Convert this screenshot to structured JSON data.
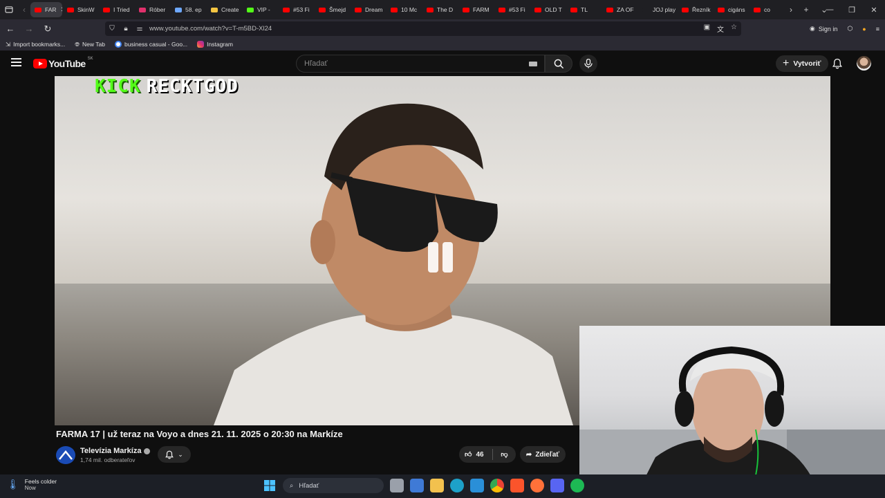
{
  "browser": {
    "tabs": [
      {
        "label": "FAR",
        "color": "#ff0000",
        "active": true
      },
      {
        "label": "SkinW",
        "color": "#ff0000"
      },
      {
        "label": "I Tried",
        "color": "#ff0000"
      },
      {
        "label": "Róber",
        "color": "#e1306c"
      },
      {
        "label": "58. ep",
        "color": "#6ea8ff"
      },
      {
        "label": "Create",
        "color": "#f4c542"
      },
      {
        "label": "VIP -",
        "color": "#53fc18"
      },
      {
        "label": "#53 Fi",
        "color": "#ff0000"
      },
      {
        "label": "Šmejd",
        "color": "#ff0000"
      },
      {
        "label": "Dream",
        "color": "#ff0000"
      },
      {
        "label": "10 Mc",
        "color": "#ff0000"
      },
      {
        "label": "The D",
        "color": "#ff0000"
      },
      {
        "label": "FARM",
        "color": "#ff0000"
      },
      {
        "label": "#53 Fi",
        "color": "#ff0000"
      },
      {
        "label": "OLD T",
        "color": "#ff0000"
      },
      {
        "label": "TL",
        "color": "#ff0000"
      },
      {
        "label": "ZA OF",
        "color": "#ff0000"
      },
      {
        "label": "JOJ play",
        "color": "#1f1f23"
      },
      {
        "label": "Řezník",
        "color": "#ff0000"
      },
      {
        "label": "cigáns",
        "color": "#ff0000"
      },
      {
        "label": "co",
        "color": "#ff0000"
      }
    ],
    "url": "www.youtube.com/watch?v=T-m5BD-Xl24",
    "sign_in": "Sign in",
    "bookmarks": [
      {
        "label": "Import bookmarks...",
        "icon": "import-icon"
      },
      {
        "label": "New Tab",
        "icon": "globe-icon"
      },
      {
        "label": "business casual - Goo...",
        "icon": "google-icon"
      },
      {
        "label": "Instagram",
        "icon": "instagram-icon"
      }
    ]
  },
  "youtube": {
    "logo_text": "YouTube",
    "country_code": "SK",
    "search_placeholder": "Hľadať",
    "create_label": "Vytvoriť",
    "overlay_brand": "KICK",
    "overlay_user": "RECKTGOD",
    "video_title": "FARMA 17 | už teraz na Voyo a dnes 21. 11. 2025 o 20:30 na Markíze",
    "channel_name": "Televízia Markíza",
    "subscribers": "1,74 mil. odberateľov",
    "likes": "46",
    "share_label": "Zdieľať"
  },
  "taskbar": {
    "weather_title": "Feels colder",
    "weather_sub": "Now",
    "search_label": "Hľadať"
  },
  "colors": {
    "youtube_red": "#ff0000",
    "kick_green": "#53fc18"
  }
}
